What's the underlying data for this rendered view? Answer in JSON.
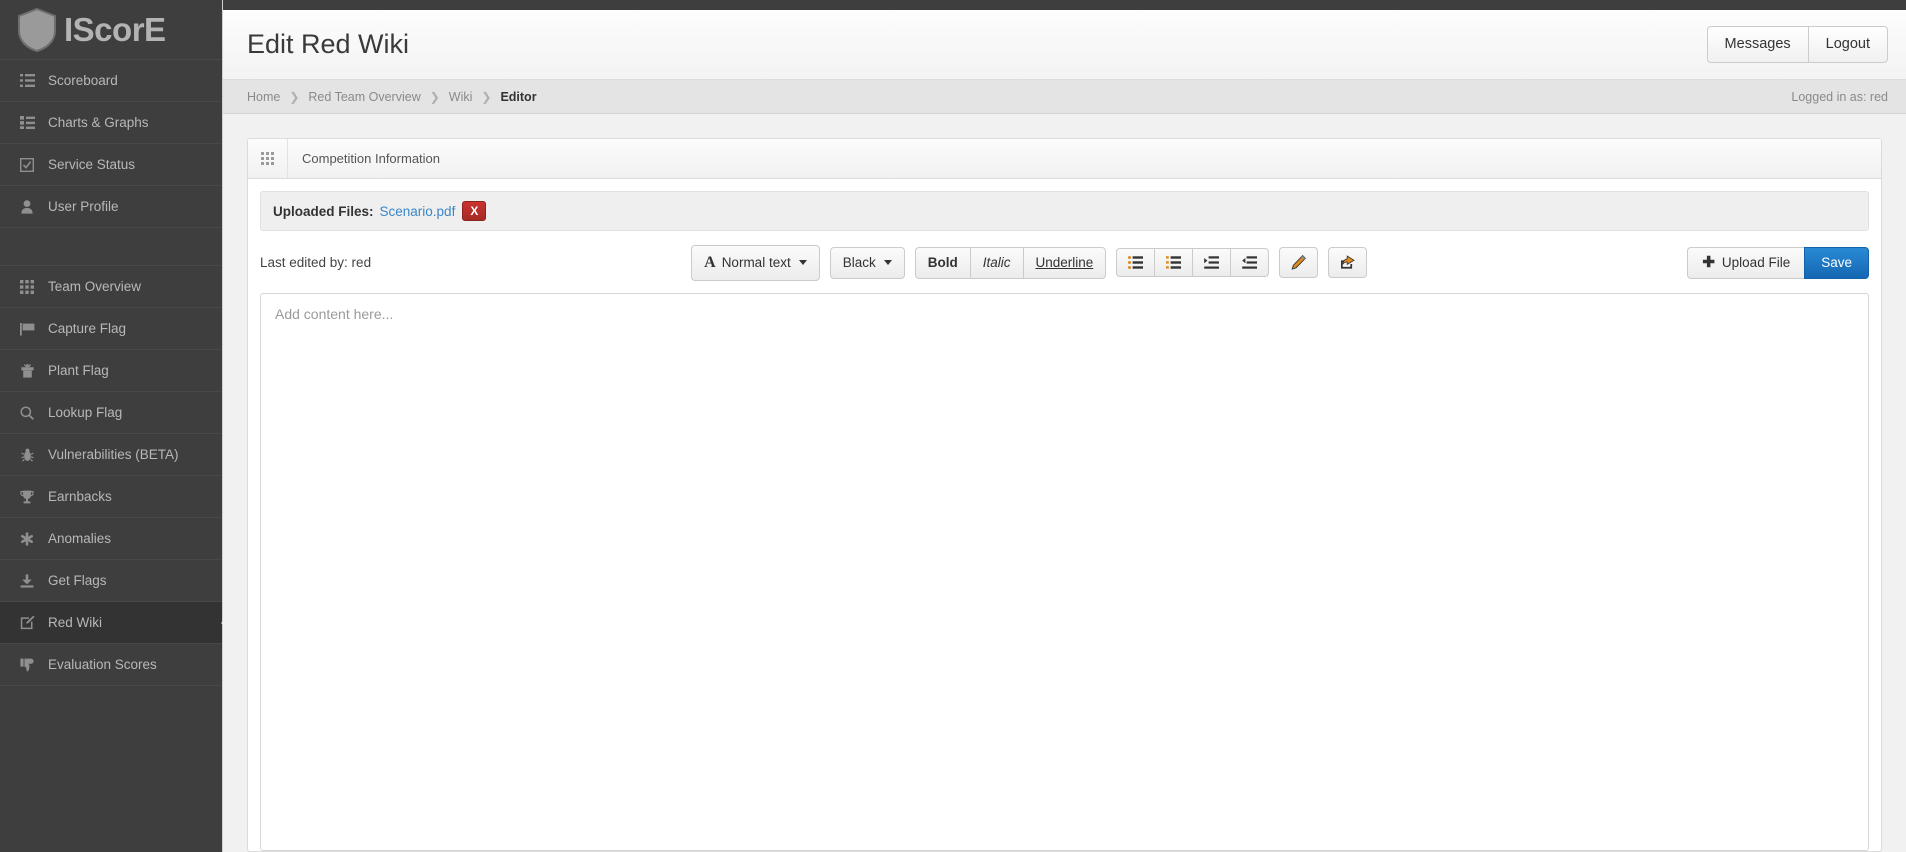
{
  "brand": {
    "name": "IScorE",
    "logo_icon": "shield-icon"
  },
  "sidebar": {
    "groups": [
      {
        "items": [
          {
            "label": "Scoreboard",
            "icon": "list-icon",
            "active": false
          },
          {
            "label": "Charts & Graphs",
            "icon": "list-alt-icon",
            "active": false
          },
          {
            "label": "Service Status",
            "icon": "check-square-icon",
            "active": false
          },
          {
            "label": "User Profile",
            "icon": "user-icon",
            "active": false
          }
        ]
      },
      {
        "items": [
          {
            "label": "Team Overview",
            "icon": "grid-icon",
            "active": false
          },
          {
            "label": "Capture Flag",
            "icon": "flag-icon",
            "active": false
          },
          {
            "label": "Plant Flag",
            "icon": "trophy-plant-icon",
            "active": false
          },
          {
            "label": "Lookup Flag",
            "icon": "search-icon",
            "active": false
          },
          {
            "label": "Vulnerabilities (BETA)",
            "icon": "bug-icon",
            "active": false
          },
          {
            "label": "Earnbacks",
            "icon": "trophy-icon",
            "active": false
          },
          {
            "label": "Anomalies",
            "icon": "asterisk-icon",
            "active": false
          },
          {
            "label": "Get Flags",
            "icon": "download-icon",
            "active": false
          },
          {
            "label": "Red Wiki",
            "icon": "edit-square-icon",
            "active": true
          },
          {
            "label": "Evaluation Scores",
            "icon": "thumbs-down-icon",
            "active": false
          }
        ]
      }
    ]
  },
  "header": {
    "title": "Edit Red Wiki",
    "messages_label": "Messages",
    "logout_label": "Logout"
  },
  "breadcrumb": {
    "items": [
      "Home",
      "Red Team Overview",
      "Wiki",
      "Editor"
    ],
    "separator": "❯",
    "logged_in": "Logged in as: red"
  },
  "panel": {
    "grid_icon": "grid-icon",
    "title": "Competition Information"
  },
  "uploaded_files": {
    "label": "Uploaded Files:",
    "file_name": "Scenario.pdf",
    "remove_label": "X"
  },
  "toolbar": {
    "last_edited": "Last edited by: red",
    "text_style_icon": "font-A-icon",
    "text_style": "Normal text",
    "color": "Black",
    "bold_label": "Bold",
    "italic_label": "Italic",
    "underline_label": "Underline",
    "list_icons": [
      "unordered-list-icon",
      "ordered-list-icon",
      "indent-icon",
      "outdent-icon"
    ],
    "pencil_icon": "pencil-icon",
    "share_icon": "share-icon",
    "upload_label": "Upload File",
    "upload_plus": "✚",
    "save_label": "Save"
  },
  "editor": {
    "placeholder": "Add content here...",
    "value": ""
  },
  "colors": {
    "sidebar_bg": "#3e3e3e",
    "sidebar_active_bg": "#333333",
    "accent_blue": "#1467b3",
    "danger_red": "#a62a26",
    "link_blue": "#3a87c8"
  }
}
